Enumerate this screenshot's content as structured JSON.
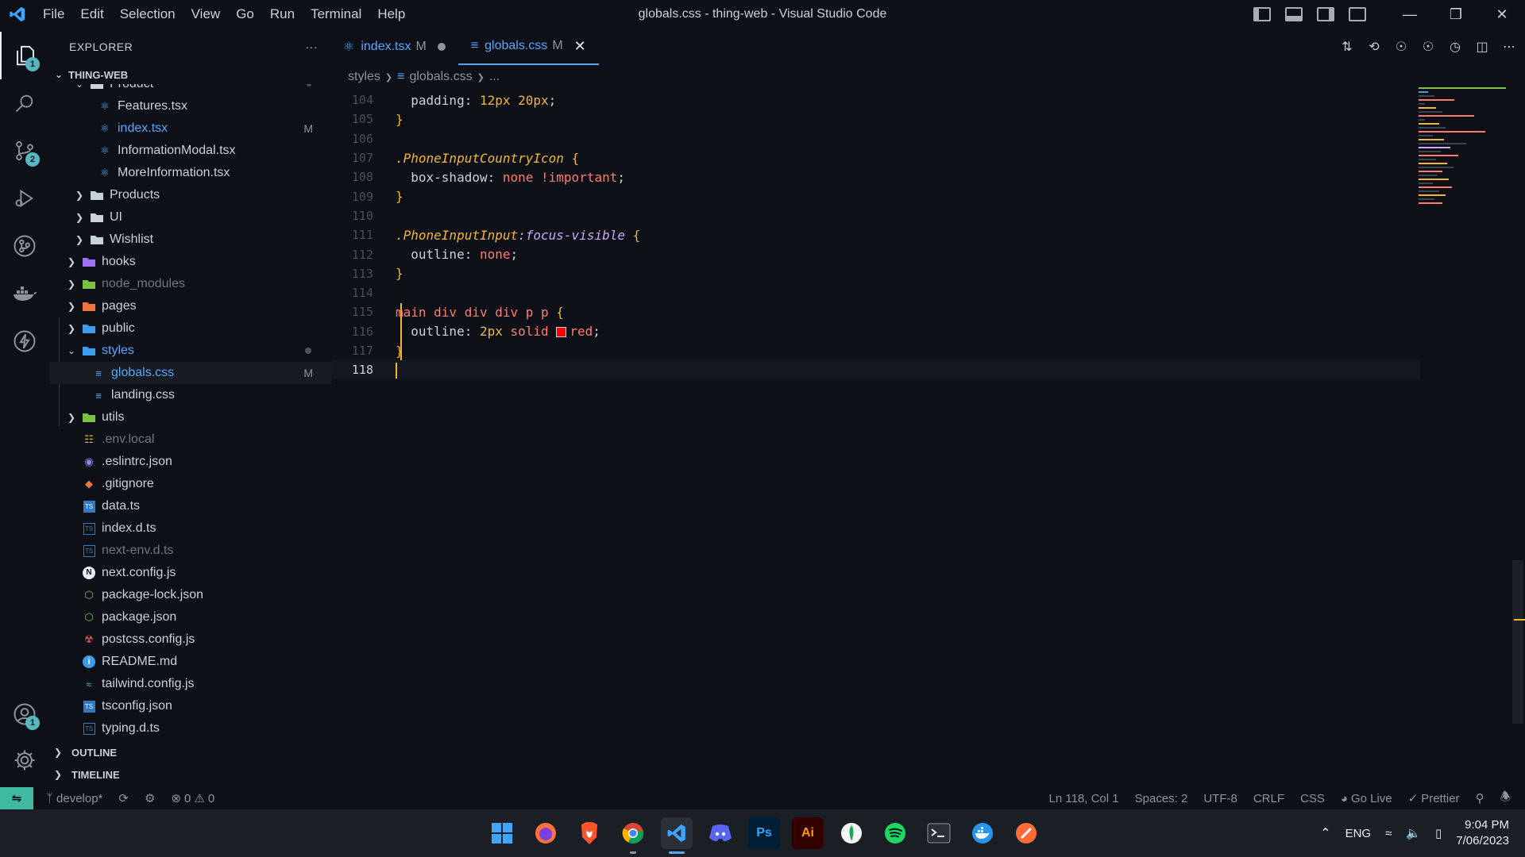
{
  "window": {
    "title": "globals.css - thing-web - Visual Studio Code",
    "menu": [
      "File",
      "Edit",
      "Selection",
      "View",
      "Go",
      "Run",
      "Terminal",
      "Help"
    ]
  },
  "activity": {
    "explorer_badge": "1",
    "scm_badge": "2",
    "accounts_badge": "1"
  },
  "sidebar": {
    "header": "EXPLORER",
    "more": "···",
    "root": "THING-WEB",
    "partial_folder": "Product",
    "items": [
      {
        "label": "Features.tsx",
        "icon": "react-icon",
        "status": ""
      },
      {
        "label": "index.tsx",
        "icon": "react-icon",
        "status": "M"
      },
      {
        "label": "InformationModal.tsx",
        "icon": "react-icon",
        "status": ""
      },
      {
        "label": "MoreInformation.tsx",
        "icon": "react-icon",
        "status": ""
      },
      {
        "label": "Products",
        "icon": "folder-icon",
        "status": ""
      },
      {
        "label": "UI",
        "icon": "folder-icon",
        "status": ""
      },
      {
        "label": "Wishlist",
        "icon": "folder-icon",
        "status": ""
      },
      {
        "label": "hooks",
        "icon": "folder-hooks-icon",
        "status": ""
      },
      {
        "label": "node_modules",
        "icon": "folder-node-icon",
        "status": ""
      },
      {
        "label": "pages",
        "icon": "folder-pages-icon",
        "status": ""
      },
      {
        "label": "public",
        "icon": "folder-public-icon",
        "status": ""
      },
      {
        "label": "styles",
        "icon": "folder-styles-icon",
        "status": ""
      },
      {
        "label": "globals.css",
        "icon": "css-icon",
        "status": "M"
      },
      {
        "label": "landing.css",
        "icon": "css-icon",
        "status": ""
      },
      {
        "label": "utils",
        "icon": "folder-utils-icon",
        "status": ""
      },
      {
        "label": ".env.local",
        "icon": "env-icon",
        "status": ""
      },
      {
        "label": ".eslintrc.json",
        "icon": "eslint-icon",
        "status": ""
      },
      {
        "label": ".gitignore",
        "icon": "git-icon",
        "status": ""
      },
      {
        "label": "data.ts",
        "icon": "ts-icon",
        "status": ""
      },
      {
        "label": "index.d.ts",
        "icon": "ts-def-icon",
        "status": ""
      },
      {
        "label": "next-env.d.ts",
        "icon": "ts-def-icon",
        "status": ""
      },
      {
        "label": "next.config.js",
        "icon": "next-icon",
        "status": ""
      },
      {
        "label": "package-lock.json",
        "icon": "node-icon",
        "status": ""
      },
      {
        "label": "package.json",
        "icon": "node-icon",
        "status": ""
      },
      {
        "label": "postcss.config.js",
        "icon": "postcss-icon",
        "status": ""
      },
      {
        "label": "README.md",
        "icon": "info-icon",
        "status": ""
      },
      {
        "label": "tailwind.config.js",
        "icon": "tailwind-icon",
        "status": ""
      },
      {
        "label": "tsconfig.json",
        "icon": "tsconfig-icon",
        "status": ""
      },
      {
        "label": "typing.d.ts",
        "icon": "ts-def-icon",
        "status": ""
      }
    ],
    "outline": "OUTLINE",
    "timeline": "TIMELINE"
  },
  "tabs": [
    {
      "label": "index.tsx",
      "mod": "M"
    },
    {
      "label": "globals.css",
      "mod": "M"
    }
  ],
  "breadcrumb": {
    "folder": "styles",
    "file": "globals.css",
    "rest": "..."
  },
  "code": {
    "lines": [
      "104",
      "105",
      "106",
      "107",
      "108",
      "109",
      "110",
      "111",
      "112",
      "113",
      "114",
      "115",
      "116",
      "117",
      "118"
    ],
    "l104_prop": "padding: ",
    "l104_val": "12px 20px",
    "l104_end": ";",
    "l105": "}",
    "l107_cls": ".PhoneInputCountryIcon",
    "l107_brace": " {",
    "l108_prop": "box-shadow: ",
    "l108_val": "none !important",
    "l108_end": ";",
    "l109": "}",
    "l111_cls": ".PhoneInputInput",
    "l111_pseudo": ":focus-visible",
    "l111_brace": " {",
    "l112_prop": "outline: ",
    "l112_val": "none",
    "l112_end": ";",
    "l113": "}",
    "l115_sel": "main div div div p p",
    "l115_brace": " {",
    "l116_prop": "outline: ",
    "l116_num": "2px",
    "l116_mid": " solid ",
    "l116_color": "red",
    "l116_end": ";",
    "l117": "}"
  },
  "status": {
    "branch": "develop*",
    "errors": "0",
    "warnings": "0",
    "position": "Ln 118, Col 1",
    "spaces": "Spaces: 2",
    "encoding": "UTF-8",
    "eol": "CRLF",
    "language": "CSS",
    "golive": "Go Live",
    "prettier": "Prettier"
  },
  "taskbar": {
    "lang": "ENG",
    "time": "9:04 PM",
    "date": "7/06/2023"
  },
  "colors": {
    "accent": "#58a6ff",
    "yellow": "#f0b72f",
    "remote": "#3fb9a0"
  }
}
